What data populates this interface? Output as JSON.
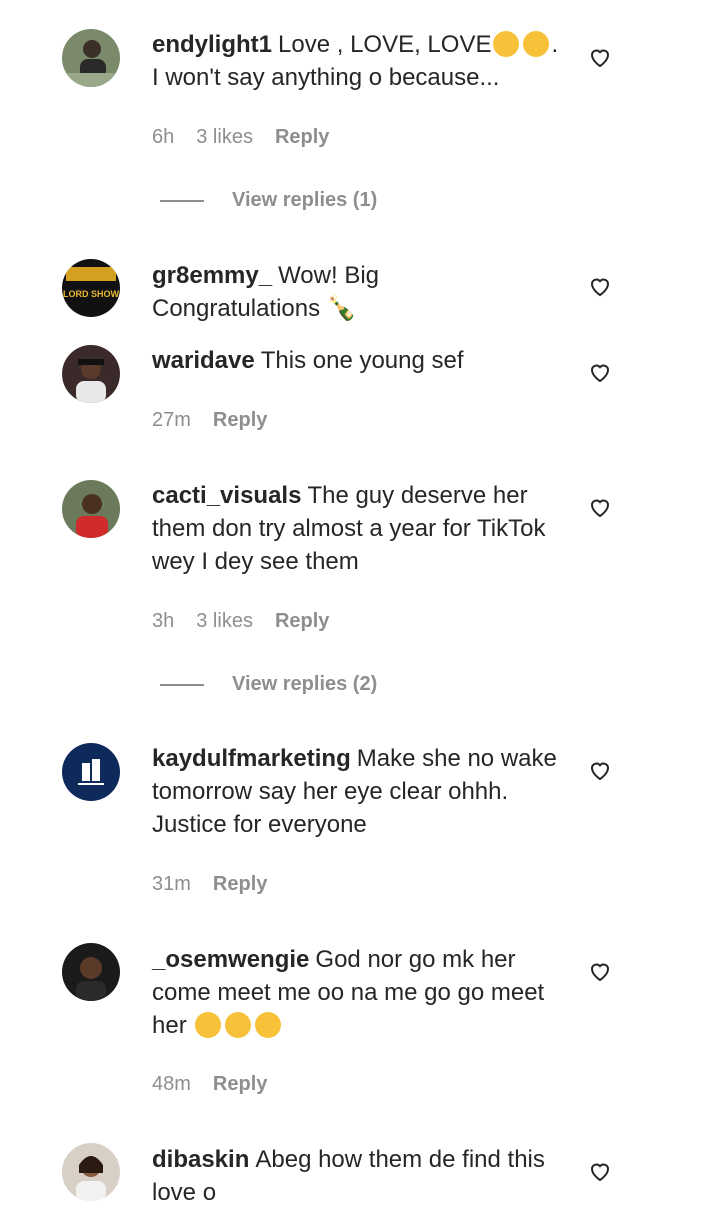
{
  "comments": [
    {
      "username": "endylight1",
      "text": "Love , LOVE, LOVE",
      "text_tail": ".",
      "text2": "I won't say anything o because...",
      "time": "6h",
      "likes": "3 likes",
      "reply": "Reply",
      "view_replies": "View replies (1)"
    },
    {
      "username": "gr8emmy_",
      "text": "Wow! Big",
      "text2": "Congratulations 🍾"
    },
    {
      "username": "waridave",
      "text": "This one young sef",
      "time": "27m",
      "reply": "Reply"
    },
    {
      "username": "cacti_visuals",
      "text": "The guy deserve her them don try almost a year for TikTok wey I dey see them",
      "time": "3h",
      "likes": "3 likes",
      "reply": "Reply",
      "view_replies": "View replies (2)"
    },
    {
      "username": "kaydulfmarketing",
      "text": "Make she no wake tomorrow say her eye clear ohhh. Justice for everyone",
      "time": "31m",
      "reply": "Reply"
    },
    {
      "username": "_osemwengie",
      "text": "God nor go mk her come meet me oo na me go go meet her",
      "time": "48m",
      "reply": "Reply"
    },
    {
      "username": "dibaskin",
      "text": "Abeg how them de find this love o"
    }
  ],
  "avatar2_badge_text": "OH LORD SHOW ME",
  "colors": {
    "text": "#262626",
    "muted": "#8e8e8e",
    "background": "#ffffff"
  }
}
